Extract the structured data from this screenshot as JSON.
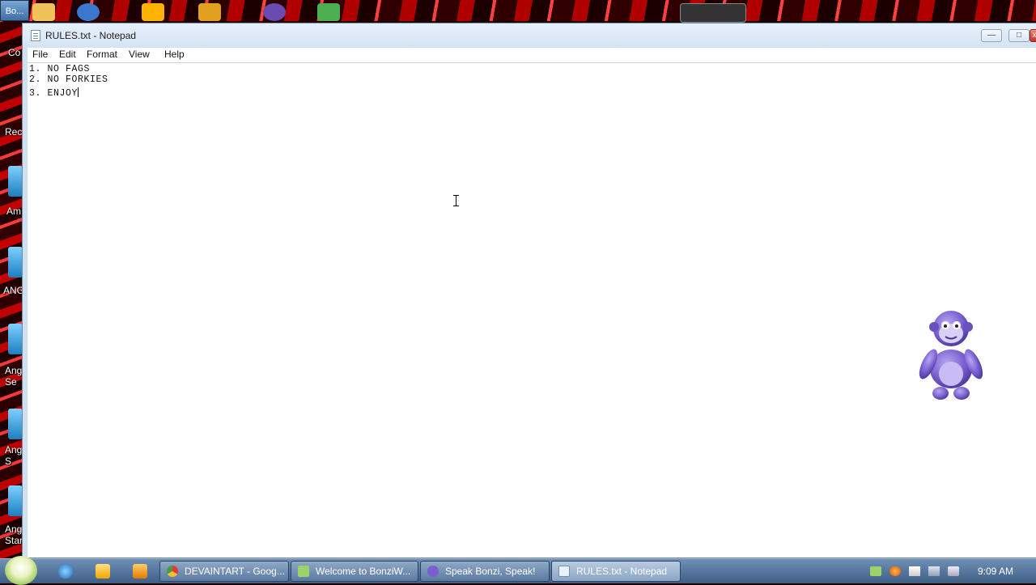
{
  "desktop": {
    "top_tab_label": "Bo...",
    "side_labels": [
      "Co",
      "Rec",
      "Am",
      "ANG",
      "Ang Se",
      "Ang S",
      "Ang Star"
    ]
  },
  "window": {
    "title": "RULES.txt - Notepad",
    "controls": {
      "minimize": "—",
      "maximize": "□",
      "close": "x"
    },
    "menu": [
      "File",
      "Edit",
      "Format",
      "View",
      "Help"
    ],
    "content_lines": [
      "1. NO FAGS",
      "2. NO FORKIES",
      "3. ENJOY"
    ]
  },
  "taskbar": {
    "buttons": [
      {
        "label": "DEVAINTART - Goog...",
        "icon": "chrome-icon",
        "active": false
      },
      {
        "label": "Welcome to BonziW...",
        "icon": "bonzi-app-icon",
        "active": false
      },
      {
        "label": "Speak Bonzi, Speak!",
        "icon": "bonzi-head-icon",
        "active": false
      },
      {
        "label": "RULES.txt - Notepad",
        "icon": "notepad-icon",
        "active": true
      }
    ],
    "clock": "9:09 AM"
  },
  "colors": {
    "wallpaper": "#b00000",
    "taskbar": "#4e6f96",
    "bonzi": "#7a5fd0"
  }
}
